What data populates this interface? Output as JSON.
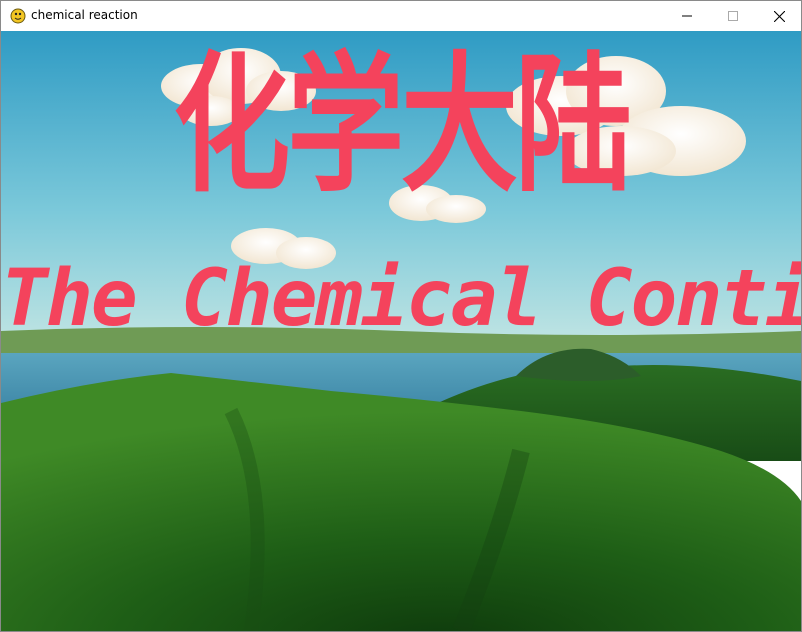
{
  "window": {
    "title": "chemical reaction",
    "controls": {
      "minimize": "minimize",
      "maximize": "maximize",
      "close": "close"
    }
  },
  "scene": {
    "title_cn": "化学大陆",
    "title_en": "The Chemical Continent",
    "colors": {
      "title": "#f4435c",
      "sky_top": "#3aa3c7",
      "sky_bottom": "#a8dde3",
      "water": "#4f97b4",
      "hills": "#2f7a1e"
    }
  }
}
